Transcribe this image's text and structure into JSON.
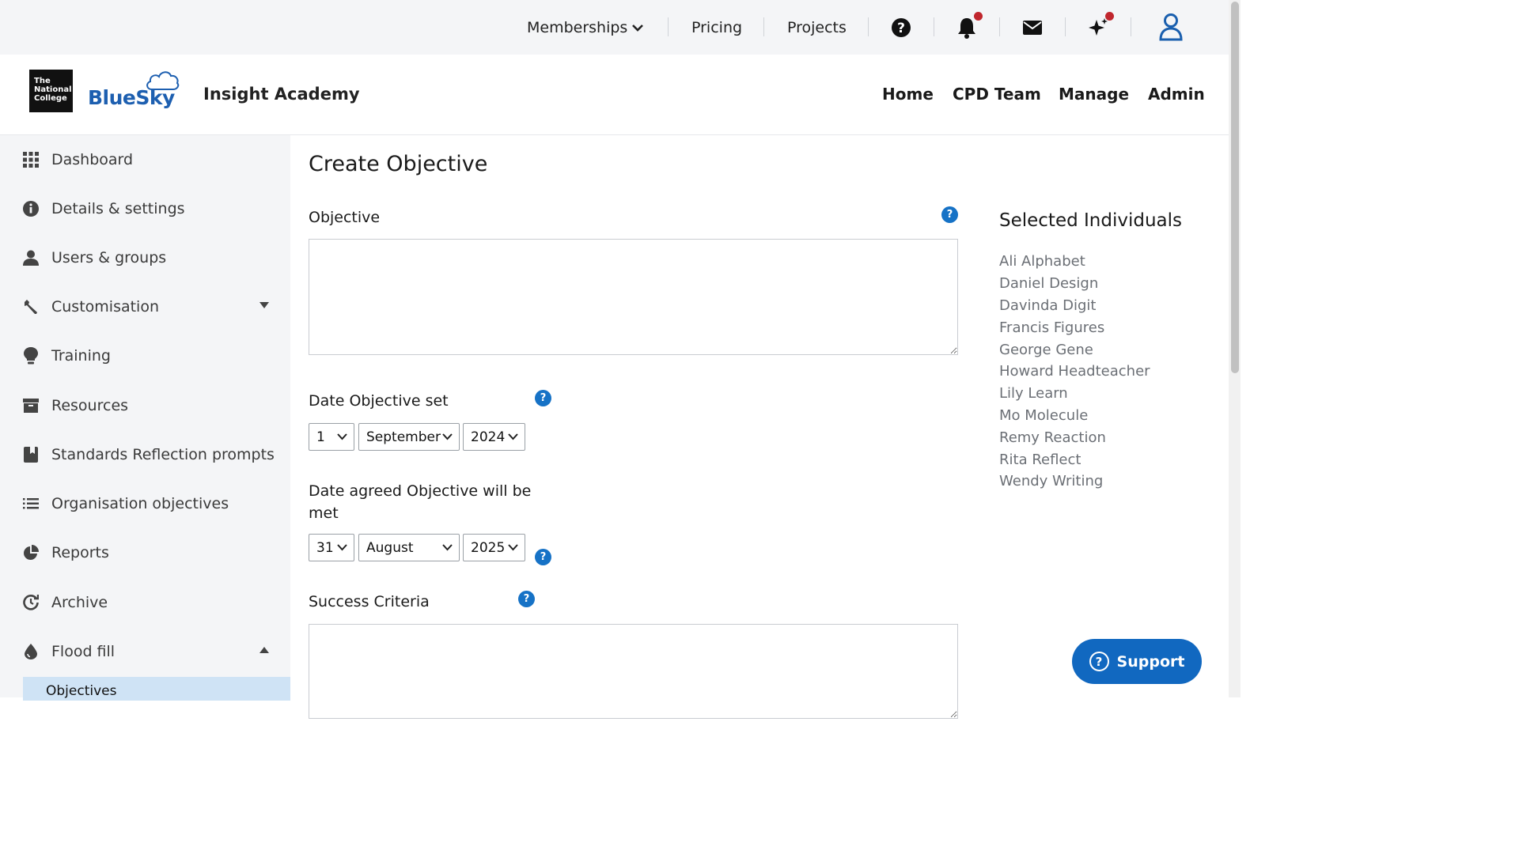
{
  "topbar": {
    "memberships": "Memberships",
    "pricing": "Pricing",
    "projects": "Projects"
  },
  "header": {
    "nc_logo": "The National College",
    "brand": "BlueSky",
    "org_name": "Insight Academy",
    "nav": [
      "Home",
      "CPD Team",
      "Manage",
      "Admin"
    ]
  },
  "sidebar": {
    "items": [
      {
        "label": "Dashboard",
        "icon": "grid-icon"
      },
      {
        "label": "Details & settings",
        "icon": "info-icon"
      },
      {
        "label": "Users & groups",
        "icon": "user-icon"
      },
      {
        "label": "Customisation",
        "icon": "wrench-icon"
      },
      {
        "label": "Training",
        "icon": "lightbulb-icon"
      },
      {
        "label": "Resources",
        "icon": "archive-icon"
      },
      {
        "label": "Standards Reflection prompts",
        "icon": "bookmark-icon"
      },
      {
        "label": "Organisation objectives",
        "icon": "list-icon"
      },
      {
        "label": "Reports",
        "icon": "pie-chart-icon"
      },
      {
        "label": "Archive",
        "icon": "history-icon"
      },
      {
        "label": "Flood fill",
        "icon": "droplet-icon"
      }
    ],
    "sub_item": "Objectives"
  },
  "main": {
    "title": "Create Objective",
    "objective_label": "Objective",
    "objective_value": "",
    "date_set_label": "Date Objective set",
    "date_set": {
      "day": "1",
      "month": "September",
      "year": "2024"
    },
    "date_met_label": "Date agreed Objective will be met",
    "date_met": {
      "day": "31",
      "month": "August",
      "year": "2025"
    },
    "success_label": "Success Criteria",
    "success_value": ""
  },
  "selected": {
    "title": "Selected Individuals",
    "people": [
      "Ali Alphabet",
      "Daniel Design",
      "Davinda Digit",
      "Francis Figures",
      "George Gene",
      "Howard Headteacher",
      "Lily Learn",
      "Mo Molecule",
      "Remy Reaction",
      "Rita Reflect",
      "Wendy Writing"
    ]
  },
  "support": {
    "label": "Support"
  },
  "colors": {
    "accent": "#1672c6",
    "sidebar_bg": "#f4f5f7",
    "active_sub": "#cfe3f5",
    "notification": "#c0262d"
  }
}
